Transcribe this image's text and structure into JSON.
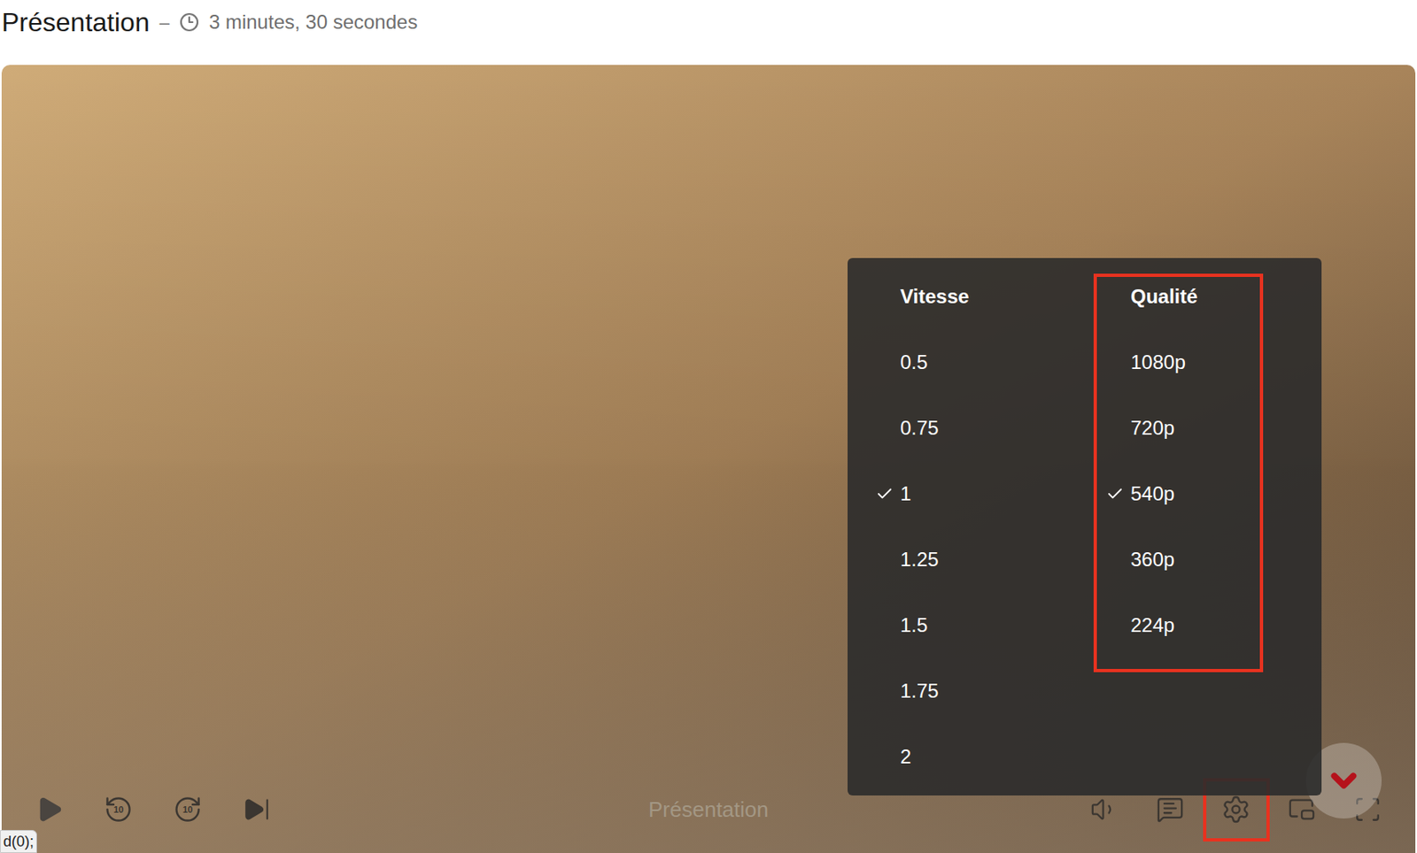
{
  "header": {
    "title": "Présentation",
    "separator": "–",
    "duration": "3 minutes, 30 secondes"
  },
  "player": {
    "playing": false,
    "title": "Présentation",
    "rewind_label": "10",
    "forward_label": "10",
    "settings_highlighted": true
  },
  "settings_menu": {
    "open": true,
    "columns": [
      {
        "title": "Vitesse",
        "highlighted": false,
        "options": [
          {
            "label": "0.5",
            "selected": false
          },
          {
            "label": "0.75",
            "selected": false
          },
          {
            "label": "1",
            "selected": true
          },
          {
            "label": "1.25",
            "selected": false
          },
          {
            "label": "1.5",
            "selected": false
          },
          {
            "label": "1.75",
            "selected": false
          },
          {
            "label": "2",
            "selected": false
          }
        ]
      },
      {
        "title": "Qualité",
        "highlighted": true,
        "options": [
          {
            "label": "1080p",
            "selected": false
          },
          {
            "label": "720p",
            "selected": false
          },
          {
            "label": "540p",
            "selected": true
          },
          {
            "label": "360p",
            "selected": false
          },
          {
            "label": "224p",
            "selected": false
          }
        ]
      }
    ]
  },
  "status_link": "d(0);"
}
